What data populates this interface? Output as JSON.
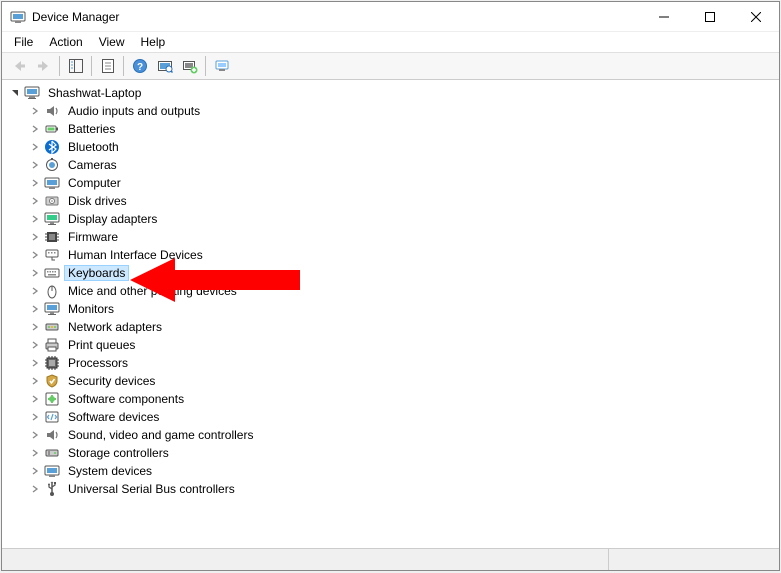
{
  "window": {
    "title": "Device Manager"
  },
  "menu": {
    "file": "File",
    "action": "Action",
    "view": "View",
    "help": "Help"
  },
  "tree": {
    "root": "Shashwat-Laptop",
    "items": [
      "Audio inputs and outputs",
      "Batteries",
      "Bluetooth",
      "Cameras",
      "Computer",
      "Disk drives",
      "Display adapters",
      "Firmware",
      "Human Interface Devices",
      "Keyboards",
      "Mice and other pointing devices",
      "Monitors",
      "Network adapters",
      "Print queues",
      "Processors",
      "Security devices",
      "Software components",
      "Software devices",
      "Sound, video and game controllers",
      "Storage controllers",
      "System devices",
      "Universal Serial Bus controllers"
    ],
    "selected_index": 9
  }
}
